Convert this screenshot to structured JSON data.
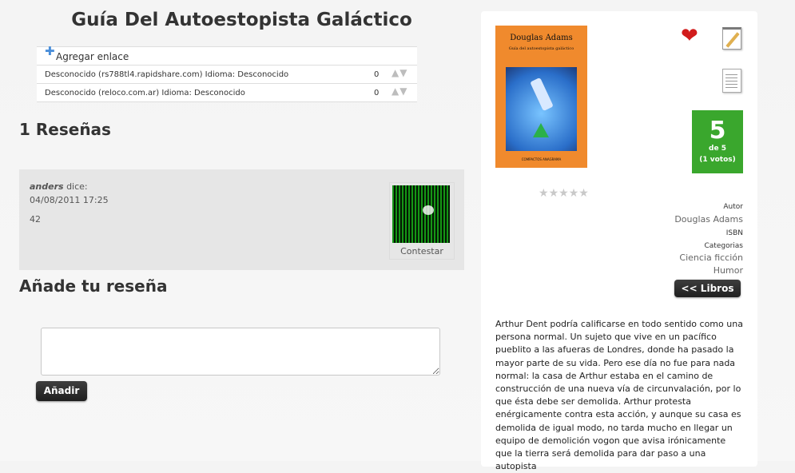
{
  "book": {
    "title": "Guía Del Autoestopista Galáctico",
    "cover": {
      "author": "Douglas Adams",
      "subtitle": "Guía del autoestopista galáctico",
      "publisher": "COMPACTOS ANAGRAMA"
    }
  },
  "links": {
    "add_label": "Agregar enlace",
    "rows": [
      {
        "host": "Desconocido (rs788tl4.rapidshare.com)",
        "language": "Idioma: Desconocido",
        "count": "0"
      },
      {
        "host": "Desconocido (reloco.com.ar)",
        "language": "Idioma: Desconocido",
        "count": "0"
      }
    ]
  },
  "reviews": {
    "heading": "1 Reseñas",
    "items": [
      {
        "user": "anders",
        "says": "dice:",
        "date": "04/08/2011 17:25",
        "text": "42",
        "reply_label": "Contestar"
      }
    ]
  },
  "add_review": {
    "heading": "Añade tu reseña",
    "button_label": "Añadir"
  },
  "sidebar": {
    "rating": {
      "score": "5",
      "of": "de 5",
      "votes": "(1 votos)",
      "stars_filled": 0,
      "stars_total": 5
    },
    "author_label": "Autor",
    "author": "Douglas Adams",
    "isbn_label": "ISBN",
    "categories_label": "Categorias",
    "categories": [
      "Ciencia ficción",
      "Humor"
    ],
    "back_button": "<< Libros",
    "description": "Arthur Dent podría calificarse en todo sentido como una persona normal. Un sujeto que vive en un pacífico pueblito a las afueras de Londres, donde ha pasado la mayor parte de su vida. Pero ese día no fue para nada normal: la casa de Arthur estaba en el camino de construcción de una nueva vía de circunvalación, por lo que ésta debe ser demolida. Arthur protesta enérgicamente contra esta acción, y aunque su casa es demolida de igual modo, no tarda mucho en llegar un equipo de demolición vogon que avisa irónicamente que la tierra será demolida para dar paso a una autopista",
    "colors": {
      "score_bg": "#3aa72d",
      "cover_bg": "#f08a2d",
      "heart": "#d11c1c"
    }
  }
}
